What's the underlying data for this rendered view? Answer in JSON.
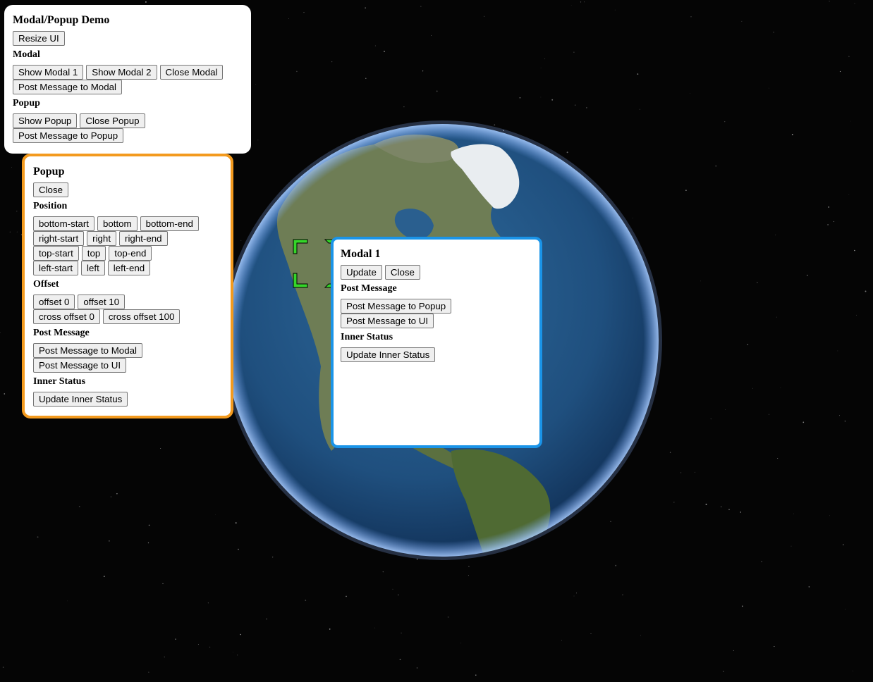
{
  "ui_panel": {
    "title": "Modal/Popup Demo",
    "resize_label": "Resize UI",
    "modal_section": "Modal",
    "show_modal_1": "Show Modal 1",
    "show_modal_2": "Show Modal 2",
    "close_modal": "Close Modal",
    "post_to_modal": "Post Message to Modal",
    "popup_section": "Popup",
    "show_popup": "Show Popup",
    "close_popup": "Close Popup",
    "post_to_popup": "Post Message to Popup"
  },
  "popup_panel": {
    "title": "Popup",
    "close_label": "Close",
    "position_section": "Position",
    "positions": [
      [
        "bottom-start",
        "bottom",
        "bottom-end"
      ],
      [
        "right-start",
        "right",
        "right-end"
      ],
      [
        "top-start",
        "top",
        "top-end"
      ],
      [
        "left-start",
        "left",
        "left-end"
      ]
    ],
    "offset_section": "Offset",
    "offset_0": "offset 0",
    "offset_10": "offset 10",
    "cross_offset_0": "cross offset 0",
    "cross_offset_100": "cross offset 100",
    "post_section": "Post Message",
    "post_to_modal": "Post Message to Modal",
    "post_to_ui": "Post Message to UI",
    "inner_section": "Inner Status",
    "update_inner": "Update Inner Status"
  },
  "modal_panel": {
    "title": "Modal 1",
    "update_label": "Update",
    "close_label": "Close",
    "post_section": "Post Message",
    "post_to_popup": "Post Message to Popup",
    "post_to_ui": "Post Message to UI",
    "inner_section": "Inner Status",
    "update_inner": "Update Inner Status"
  },
  "colors": {
    "popup_border": "#f39a1e",
    "modal_border": "#1a94e8",
    "space": "#050505",
    "marker": "#35d629"
  }
}
